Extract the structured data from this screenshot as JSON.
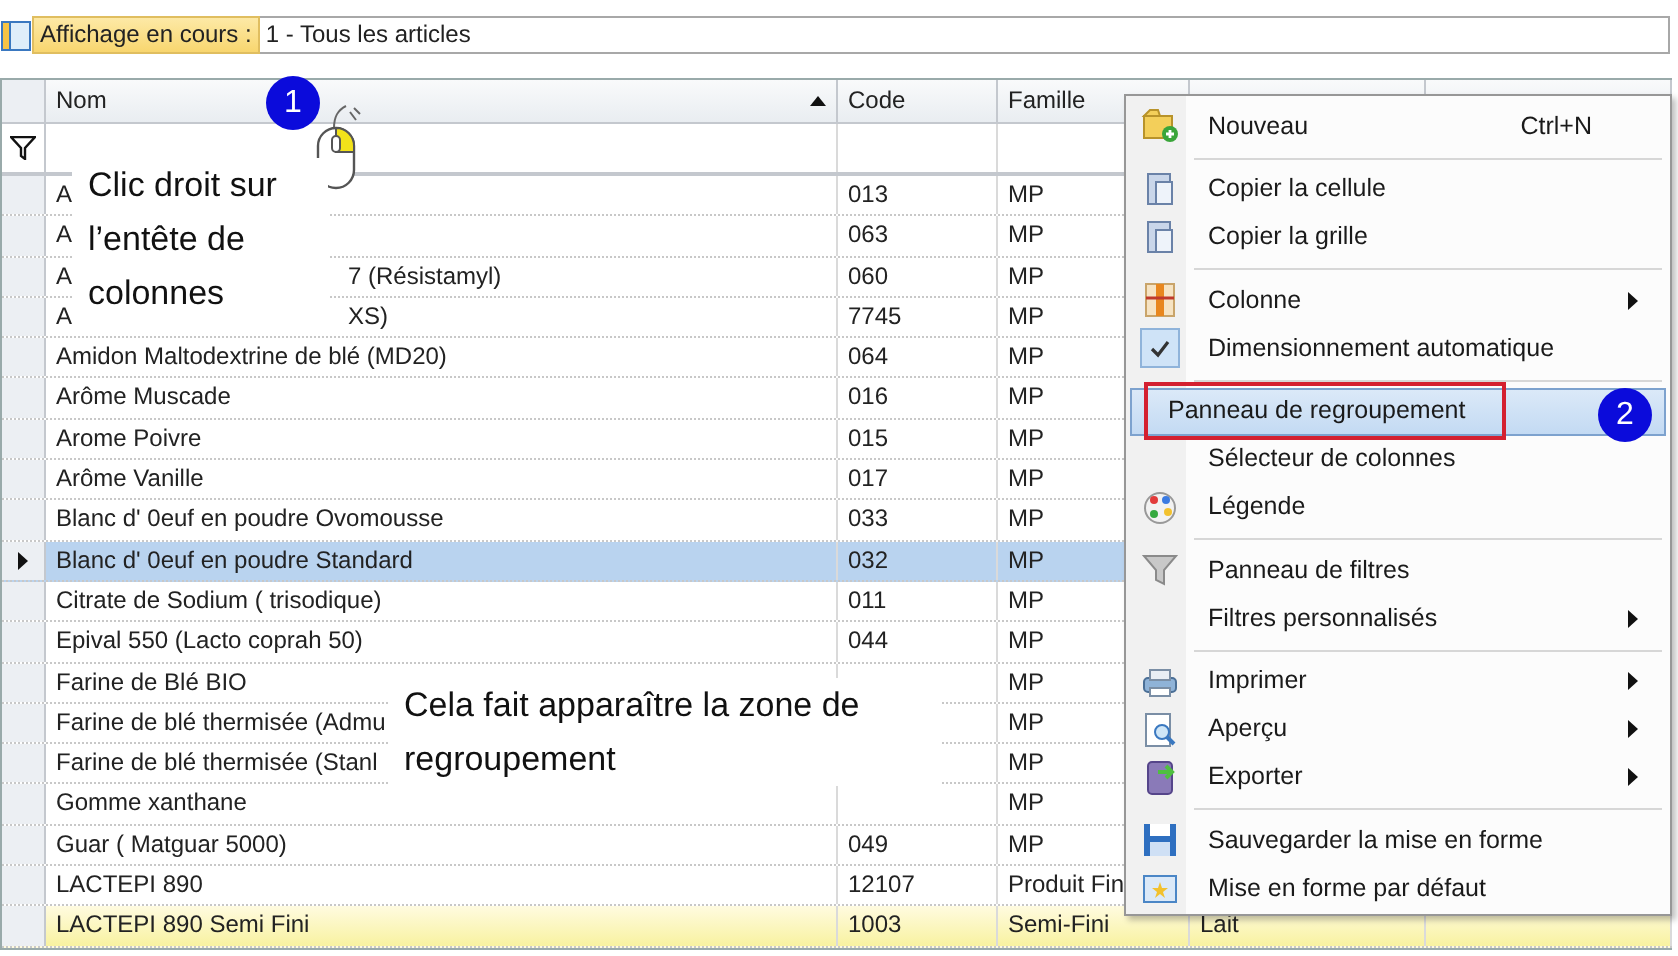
{
  "view_bar": {
    "label": "Affichage en cours :",
    "value": "1 - Tous les articles"
  },
  "grid": {
    "columns": [
      {
        "label": "Nom",
        "sorted": true
      },
      {
        "label": "Code"
      },
      {
        "label": "Famille"
      }
    ],
    "rows": [
      {
        "name": "A",
        "selected": false,
        "highlighted": false,
        "code": "013",
        "famille": "MP"
      },
      {
        "name": "A",
        "selected": false,
        "highlighted": false,
        "code": "063",
        "famille": "MP"
      },
      {
        "name": "A",
        "name_tail": "7 (Résistamyl)",
        "selected": false,
        "highlighted": false,
        "code": "060",
        "famille": "MP"
      },
      {
        "name": "A",
        "name_tail": "XS)",
        "selected": false,
        "highlighted": false,
        "code": "7745",
        "famille": "MP"
      },
      {
        "name": "Amidon Maltodextrine de blé (MD20)",
        "selected": false,
        "highlighted": false,
        "code": "064",
        "famille": "MP"
      },
      {
        "name": "Arôme Muscade",
        "selected": false,
        "highlighted": false,
        "code": "016",
        "famille": "MP"
      },
      {
        "name": "Arome Poivre",
        "selected": false,
        "highlighted": false,
        "code": "015",
        "famille": "MP"
      },
      {
        "name": "Arôme Vanille",
        "selected": false,
        "highlighted": false,
        "code": "017",
        "famille": "MP"
      },
      {
        "name": "Blanc d' 0euf en poudre Ovomousse",
        "selected": false,
        "highlighted": false,
        "code": "033",
        "famille": "MP"
      },
      {
        "name": "Blanc d' 0euf en poudre Standard",
        "selected": true,
        "highlighted": false,
        "code": "032",
        "famille": "MP"
      },
      {
        "name": "Citrate de Sodium ( trisodique)",
        "selected": false,
        "highlighted": false,
        "code": "011",
        "famille": "MP"
      },
      {
        "name": "Epival 550 (Lacto coprah 50)",
        "selected": false,
        "highlighted": false,
        "code": "044",
        "famille": "MP"
      },
      {
        "name": "Farine de Blé BIO",
        "selected": false,
        "highlighted": false,
        "famille": "MP"
      },
      {
        "name": "Farine de blé thermisée (Admu",
        "selected": false,
        "highlighted": false,
        "famille": "MP"
      },
      {
        "name": "Farine de blé thermisée (Stanl",
        "selected": false,
        "highlighted": false,
        "famille": "MP"
      },
      {
        "name": "Gomme xanthane",
        "selected": false,
        "highlighted": false,
        "famille": "MP"
      },
      {
        "name": "Guar ( Matguar 5000)",
        "selected": false,
        "highlighted": false,
        "code": "049",
        "famille": "MP"
      },
      {
        "name": "LACTEPI 890",
        "selected": false,
        "highlighted": false,
        "code": "12107",
        "famille": "Produit Fin"
      },
      {
        "name": "LACTEPI 890 Semi Fini",
        "selected": false,
        "highlighted": true,
        "code": "1003",
        "famille": "Semi-Fini",
        "column_4": "Lait"
      }
    ]
  },
  "context_menu": {
    "items": [
      {
        "kind": "item",
        "label": "Nouveau",
        "shortcut": "Ctrl+N",
        "selected": false
      },
      {
        "kind": "separator"
      },
      {
        "kind": "item",
        "label": "Copier la cellule",
        "selected": false
      },
      {
        "kind": "item",
        "label": "Copier la grille",
        "selected": false
      },
      {
        "kind": "separator"
      },
      {
        "kind": "item",
        "label": "Colonne",
        "submenu": true,
        "selected": false
      },
      {
        "kind": "item",
        "label": "Dimensionnement automatique",
        "checked": true,
        "selected": false
      },
      {
        "kind": "separator"
      },
      {
        "kind": "item",
        "label": "Panneau de regroupement",
        "selected": true
      },
      {
        "kind": "item",
        "label": "Sélecteur de colonnes",
        "selected": false
      },
      {
        "kind": "item",
        "label": "Légende",
        "selected": false
      },
      {
        "kind": "separator"
      },
      {
        "kind": "item",
        "label": "Panneau de filtres",
        "selected": false
      },
      {
        "kind": "item",
        "label": "Filtres personnalisés",
        "submenu": true,
        "selected": false
      },
      {
        "kind": "separator"
      },
      {
        "kind": "item",
        "label": "Imprimer",
        "submenu": true,
        "selected": false
      },
      {
        "kind": "item",
        "label": "Aperçu",
        "submenu": true,
        "selected": false
      },
      {
        "kind": "item",
        "label": "Exporter",
        "submenu": true,
        "selected": false
      },
      {
        "kind": "separator"
      },
      {
        "kind": "item",
        "label": "Sauvegarder la mise en forme",
        "selected": false
      },
      {
        "kind": "item",
        "label": "Mise en forme par défaut",
        "selected": false
      }
    ]
  },
  "annotations": [
    {
      "kind": "badge",
      "text": "1"
    },
    {
      "kind": "mouse"
    },
    {
      "kind": "callout",
      "text": "Clic droit sur l’entête de colonnes"
    },
    {
      "kind": "frame"
    },
    {
      "kind": "badge",
      "text": "2"
    },
    {
      "kind": "callout",
      "text": "Cela fait apparaître la zone de regroupement"
    }
  ]
}
